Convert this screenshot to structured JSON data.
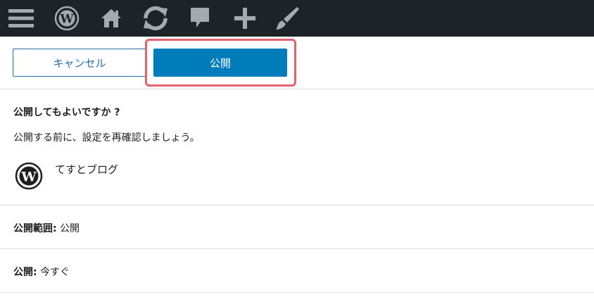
{
  "adminbar": {
    "icons": [
      "menu-icon",
      "wordpress-logo-icon",
      "home-icon",
      "updates-icon",
      "comments-icon",
      "new-content-icon",
      "customize-brush-icon"
    ],
    "background": "#1d2327",
    "icon_color": "#a7aaad"
  },
  "actions": {
    "cancel_label": "キャンセル",
    "publish_label": "公開",
    "accent": "#007cba",
    "highlight_color": "#e5636e"
  },
  "prepublish": {
    "title": "公開してもよいですか ?",
    "description": "公開する前に、設定を再確認しましょう。",
    "site_name": "てすとブログ"
  },
  "visibility": {
    "label": "公開範囲:",
    "value": "公開"
  },
  "schedule": {
    "label": "公開:",
    "value": "今すぐ"
  }
}
